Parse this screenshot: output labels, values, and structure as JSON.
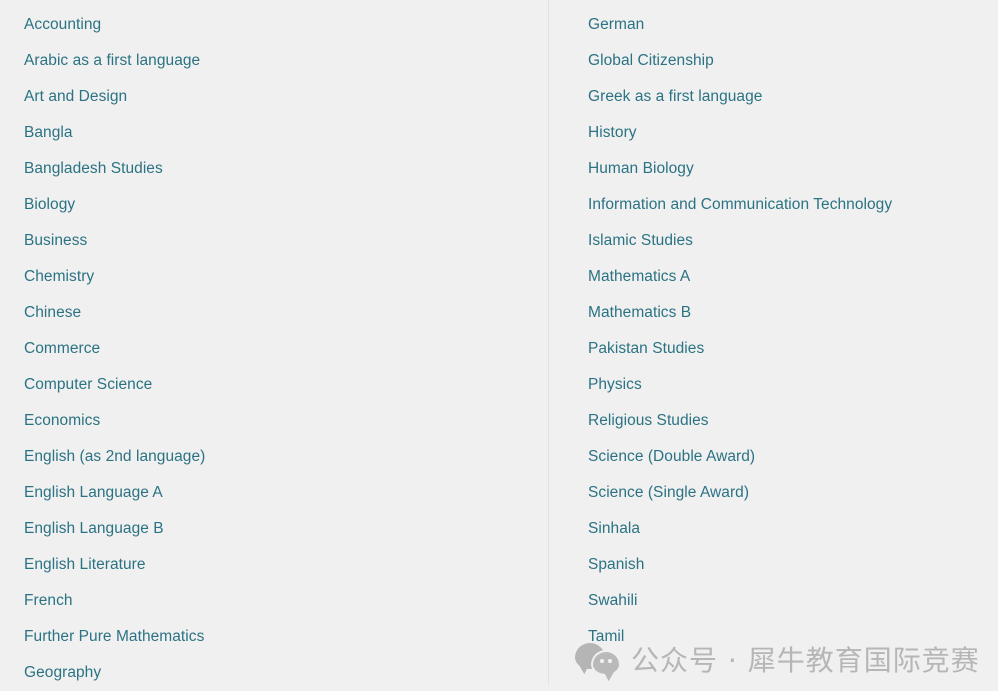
{
  "theme": {
    "background_color": "#f0f0f0",
    "link_color": "#2b7383",
    "divider_color": "#e2e2e2",
    "watermark_color": "#b6b6b6"
  },
  "subject_list": {
    "left_column": [
      {
        "label": "Accounting"
      },
      {
        "label": "Arabic as a first language"
      },
      {
        "label": "Art and Design"
      },
      {
        "label": "Bangla"
      },
      {
        "label": "Bangladesh Studies"
      },
      {
        "label": "Biology"
      },
      {
        "label": "Business"
      },
      {
        "label": "Chemistry"
      },
      {
        "label": "Chinese"
      },
      {
        "label": "Commerce"
      },
      {
        "label": "Computer Science"
      },
      {
        "label": "Economics"
      },
      {
        "label": "English (as 2nd language)"
      },
      {
        "label": "English Language A"
      },
      {
        "label": "English Language B"
      },
      {
        "label": "English Literature"
      },
      {
        "label": "French"
      },
      {
        "label": "Further Pure Mathematics"
      },
      {
        "label": "Geography"
      }
    ],
    "right_column": [
      {
        "label": "German"
      },
      {
        "label": "Global Citizenship"
      },
      {
        "label": "Greek as a first language"
      },
      {
        "label": "History"
      },
      {
        "label": "Human Biology"
      },
      {
        "label": "Information and Communication Technology"
      },
      {
        "label": "Islamic Studies"
      },
      {
        "label": "Mathematics A"
      },
      {
        "label": "Mathematics B"
      },
      {
        "label": "Pakistan Studies"
      },
      {
        "label": "Physics"
      },
      {
        "label": "Religious Studies"
      },
      {
        "label": "Science (Double Award)"
      },
      {
        "label": "Science (Single Award)"
      },
      {
        "label": "Sinhala"
      },
      {
        "label": "Spanish"
      },
      {
        "label": "Swahili"
      },
      {
        "label": "Tamil"
      }
    ]
  },
  "watermark": {
    "icon": "wechat-logo-icon",
    "text": "公众号 · 犀牛教育国际竞赛"
  }
}
